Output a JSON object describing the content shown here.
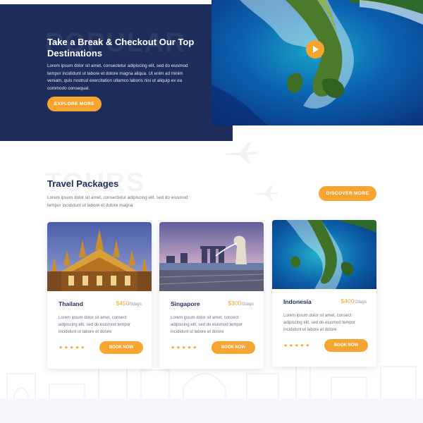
{
  "hero": {
    "watermark": "POPULAR",
    "title": "Take a Break & Checkout Our Top Destinations",
    "text": "Lorem ipsum dolor sit amet, consectetur adipiscing elit, sed do eiusmod tempor incididunt ut labore et dolore magna aliqua. Ut enim ad minim veniam, quis nostrud exercitation ullamco laboris nisi ut aliquip ex ea commodo consequat.",
    "explore_label": "EXPLORE MORE",
    "play_icon": "play-icon"
  },
  "packages": {
    "watermark": "TOURS",
    "title": "Travel Packages",
    "text": "Lorem ipsum dolor sit amet, consectetur adipiscing elit, sed do eiusmod tempor incididunt ut labore et dolore magna",
    "discover_label": "DISCOVER MORE"
  },
  "cards": [
    {
      "name": "Thailand",
      "price": "$450",
      "duration": "/3days",
      "text": "Lorem ipsum dolor sit amet, consect adipiscing elit, sed do eiusmod tempor incididunt ut labore et dolore",
      "stars": "★★★★★",
      "rating": 5,
      "book_label": "BOOK NOW"
    },
    {
      "name": "Singapore",
      "price": "$300",
      "duration": "/2days",
      "text": "Lorem ipsum dolor sit amet, consect adipiscing elit, sed do eiusmod tempor incididunt ut labore et dolore",
      "stars": "★★★★★",
      "rating": 5,
      "book_label": "BOOK NOW"
    },
    {
      "name": "Indonesia",
      "price": "$400",
      "duration": "/2days",
      "text": "Lorem ipsum dolor sit amet, consect adipiscing elit, sed do eiusmod tempor incididunt ut labore et dolore",
      "stars": "★★★★★",
      "rating": 5,
      "book_label": "BOOK NOW"
    }
  ],
  "colors": {
    "navy": "#1d2e5c",
    "accent": "#f7a531",
    "muted": "#6b7280"
  }
}
